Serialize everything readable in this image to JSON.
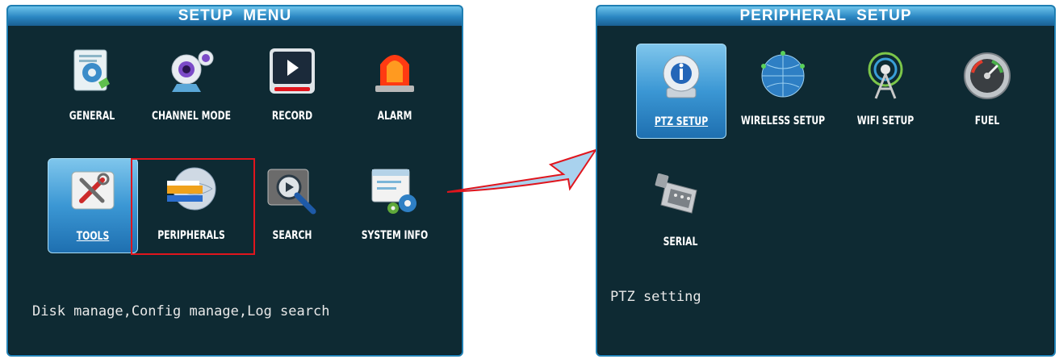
{
  "setup_menu": {
    "title": "SETUP  MENU",
    "items": [
      {
        "label": "GENERAL",
        "icon": "document-gear-icon"
      },
      {
        "label": "CHANNEL MODE",
        "icon": "webcam-icon"
      },
      {
        "label": "RECORD",
        "icon": "play-record-icon"
      },
      {
        "label": "ALARM",
        "icon": "siren-icon"
      },
      {
        "label": "TOOLS",
        "icon": "tools-icon",
        "selected": true
      },
      {
        "label": "PERIPHERALS",
        "icon": "globe-peripherals-icon",
        "highlighted": true
      },
      {
        "label": "SEARCH",
        "icon": "search-film-icon"
      },
      {
        "label": "SYSTEM INFO",
        "icon": "window-gears-icon"
      }
    ],
    "status_text": "Disk manage,Config manage,Log search"
  },
  "peripheral_setup": {
    "title": "PERIPHERAL  SETUP",
    "items": [
      {
        "label": "PTZ SETUP",
        "icon": "ptz-camera-icon",
        "selected": true
      },
      {
        "label": "WIRELESS SETUP",
        "icon": "wireless-globe-icon"
      },
      {
        "label": "WIFI SETUP",
        "icon": "wifi-tower-icon"
      },
      {
        "label": "FUEL",
        "icon": "fuel-gauge-icon"
      },
      {
        "label": "SERIAL",
        "icon": "serial-connector-icon"
      }
    ],
    "status_text": "PTZ setting"
  },
  "colors": {
    "panel_bg": "#0e2a33",
    "title_bar": "#2a86c2",
    "selected_tile": "#3b97d4",
    "highlight_border": "#e0151d",
    "arrow_fill": "#a9d2ee",
    "arrow_stroke": "#e0151d"
  }
}
